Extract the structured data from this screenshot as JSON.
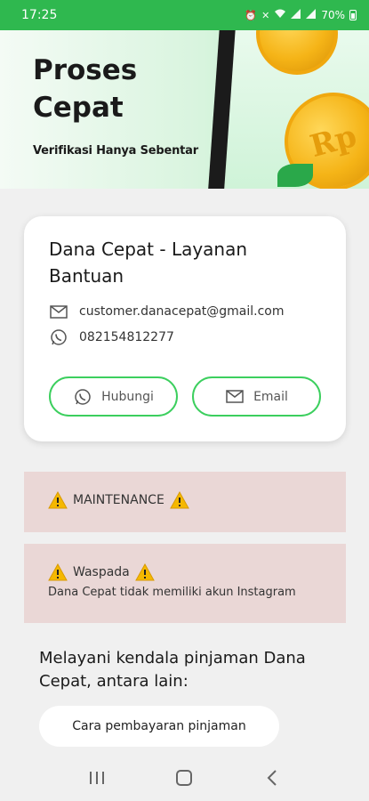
{
  "status_bar": {
    "time": "17:25",
    "battery": "70%"
  },
  "banner": {
    "title_line1": "Proses",
    "title_line2": "Cepat",
    "subtitle": "Verifikasi Hanya Sebentar",
    "coin_text": "Rp"
  },
  "card": {
    "title": "Dana Cepat - Layanan Bantuan",
    "email": "customer.danacepat@gmail.com",
    "phone": "082154812277",
    "contact_button": "Hubungi",
    "email_button": "Email"
  },
  "alerts": {
    "maintenance": "MAINTENANCE",
    "waspada_title": "Waspada",
    "waspada_desc": "Dana Cepat tidak memiliki akun Instagram"
  },
  "info": {
    "heading": "Melayani kendala pinjaman Dana Cepat, antara lain:",
    "chip": "Cara pembayaran pinjaman"
  },
  "colors": {
    "accent": "#2fb84f",
    "alert_bg": "#ead7d6",
    "button_border": "#3ccf5e"
  },
  "icons": [
    "mail-icon",
    "whatsapp-icon",
    "warning-icon",
    "recents-icon",
    "home-icon",
    "back-icon"
  ]
}
